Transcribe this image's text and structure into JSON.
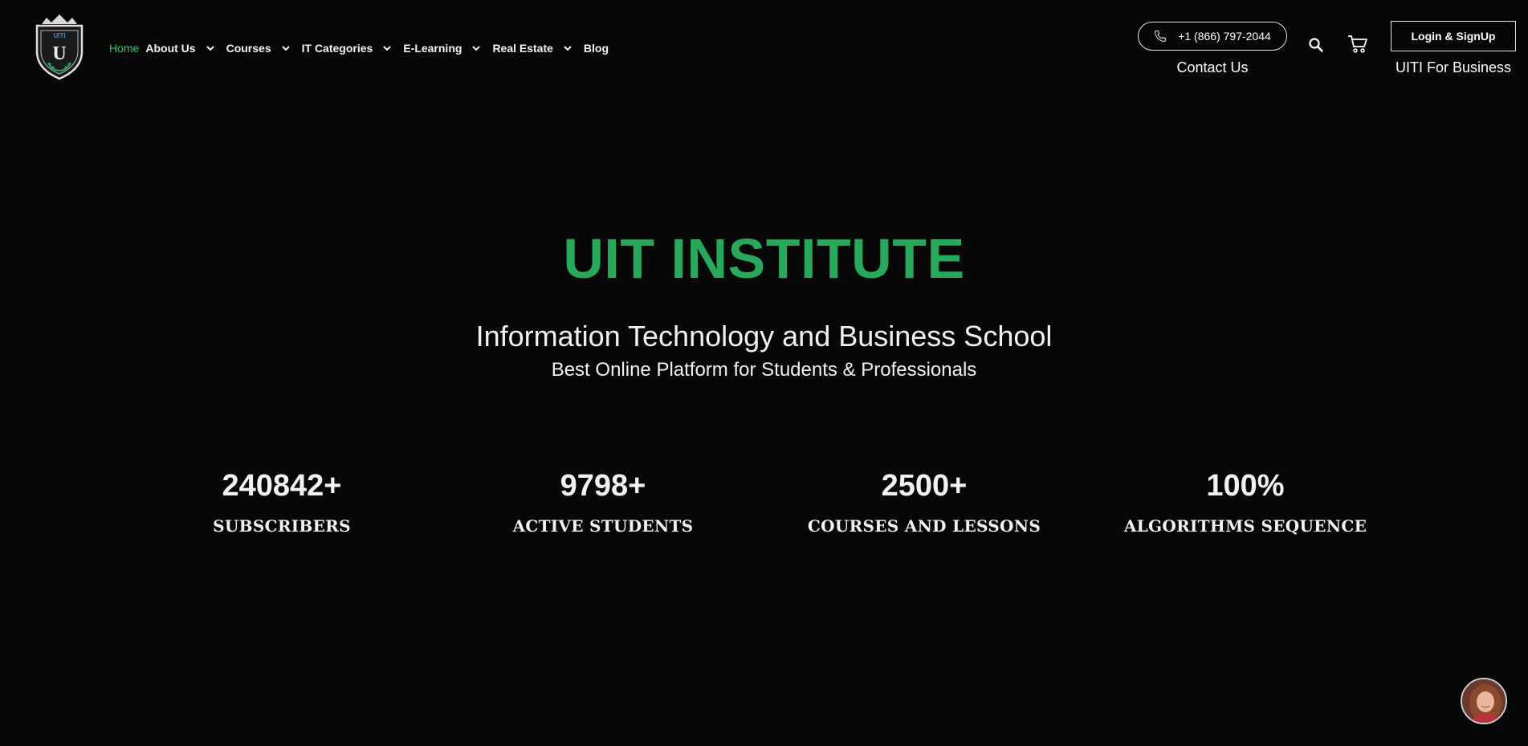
{
  "logo": {
    "text": "UITI",
    "icon": "shield-logo"
  },
  "nav": {
    "items": [
      {
        "label": "Home",
        "active": true,
        "dropdown": false
      },
      {
        "label": "About Us",
        "active": false,
        "dropdown": true
      },
      {
        "label": "Courses",
        "active": false,
        "dropdown": true
      },
      {
        "label": "IT Categories",
        "active": false,
        "dropdown": true
      },
      {
        "label": "E-Learning",
        "active": false,
        "dropdown": true
      },
      {
        "label": "Real Estate",
        "active": false,
        "dropdown": true
      },
      {
        "label": "Blog",
        "active": false,
        "dropdown": false
      }
    ]
  },
  "header": {
    "phone": "+1 (866) 797-2044",
    "contact_label": "Contact Us",
    "login_label": "Login & SignUp",
    "business_label": "UITI For Business",
    "search_icon": "search-icon",
    "cart_icon": "cart-icon"
  },
  "hero": {
    "title": "UIT INSTITUTE",
    "subtitle": "Information Technology and Business School",
    "tagline": "Best Online Platform for Students & Professionals"
  },
  "stats": [
    {
      "value": "240842+",
      "label": "SUBSCRIBERS"
    },
    {
      "value": "9798+",
      "label": "ACTIVE STUDENTS"
    },
    {
      "value": "2500+",
      "label": "COURSES AND LESSONS"
    },
    {
      "value": "100%",
      "label": "ALGORITHMS SEQUENCE"
    }
  ],
  "colors": {
    "background": "#070707",
    "accent": "#27a85a",
    "nav_active": "#35c46a",
    "text": "#f2f2f2"
  }
}
